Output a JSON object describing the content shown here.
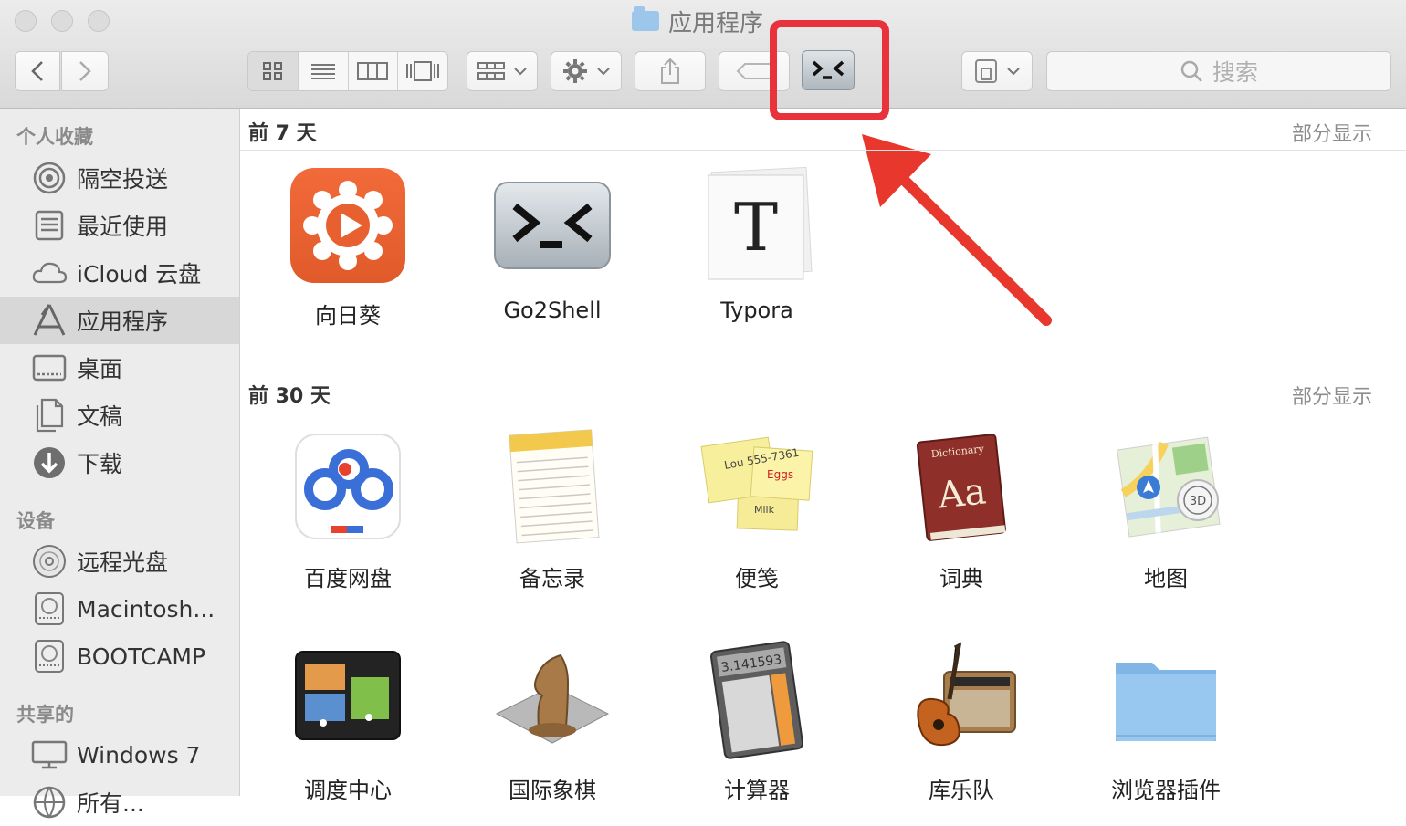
{
  "window": {
    "title": "应用程序"
  },
  "toolbar": {
    "back_icon": "chevron-left-icon",
    "forward_icon": "chevron-right-icon",
    "view_modes": [
      "icon-view",
      "list-view",
      "column-view",
      "coverflow-view"
    ],
    "search_placeholder": "搜索"
  },
  "sidebar": {
    "favorites_header": "个人收藏",
    "favorites": [
      {
        "label": "隔空投送",
        "icon": "airdrop-icon"
      },
      {
        "label": "最近使用",
        "icon": "recents-icon"
      },
      {
        "label": "iCloud 云盘",
        "icon": "cloud-icon"
      },
      {
        "label": "应用程序",
        "icon": "applications-icon",
        "active": true
      },
      {
        "label": "桌面",
        "icon": "desktop-icon"
      },
      {
        "label": "文稿",
        "icon": "documents-icon"
      },
      {
        "label": "下载",
        "icon": "download-icon"
      }
    ],
    "devices_header": "设备",
    "devices": [
      {
        "label": "远程光盘",
        "icon": "disc-icon"
      },
      {
        "label": "Macintosh...",
        "icon": "drive-icon"
      },
      {
        "label": "BOOTCAMP",
        "icon": "drive-icon"
      }
    ],
    "shared_header": "共享的",
    "shared": [
      {
        "label": "Windows 7",
        "icon": "computer-icon"
      },
      {
        "label": "所有...",
        "icon": "network-icon"
      }
    ]
  },
  "main": {
    "sections": [
      {
        "title": "前 7 天",
        "more": "部分显示",
        "apps": [
          {
            "label": "向日葵",
            "icon": "sunflower-icon"
          },
          {
            "label": "Go2Shell",
            "icon": "go2shell-icon"
          },
          {
            "label": "Typora",
            "icon": "typora-icon"
          }
        ]
      },
      {
        "title": "前 30 天",
        "more": "部分显示",
        "apps": [
          {
            "label": "百度网盘",
            "icon": "baidu-netdisk-icon"
          },
          {
            "label": "备忘录",
            "icon": "notes-icon"
          },
          {
            "label": "便笺",
            "icon": "stickies-icon"
          },
          {
            "label": "词典",
            "icon": "dictionary-icon"
          },
          {
            "label": "地图",
            "icon": "maps-icon"
          },
          {
            "label": "调度中心",
            "icon": "mission-control-icon"
          },
          {
            "label": "国际象棋",
            "icon": "chess-icon"
          },
          {
            "label": "计算器",
            "icon": "calculator-icon"
          },
          {
            "label": "库乐队",
            "icon": "garageband-icon"
          },
          {
            "label": "浏览器插件",
            "icon": "folder-icon"
          }
        ]
      }
    ]
  },
  "icon_text": {
    "typora_letter": "T",
    "dictionary_title": "Dictionary",
    "dictionary_letters": "Aa",
    "maps_badge": "3D",
    "calculator_display": "3.141593",
    "stickies_note1": "Lou 555-7361",
    "stickies_note2": "Eggs",
    "stickies_note3": "Milk"
  },
  "colors": {
    "highlight": "#e8323c",
    "arrow": "#e8382d",
    "sidebar_bg": "#ececec"
  }
}
